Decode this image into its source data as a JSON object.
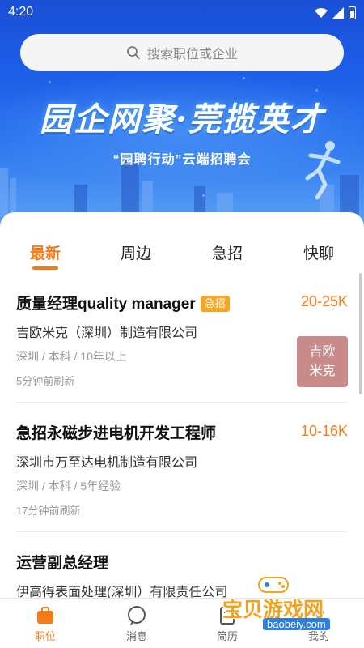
{
  "status_bar": {
    "time": "4:20"
  },
  "search": {
    "placeholder": "搜索职位或企业"
  },
  "banner": {
    "title": "园企网聚·莞揽英才",
    "subtitle": "“园聘行动”云端招聘会"
  },
  "tabs": [
    {
      "label": "最新",
      "active": true
    },
    {
      "label": "周边",
      "active": false
    },
    {
      "label": "急招",
      "active": false
    },
    {
      "label": "快聊",
      "active": false
    }
  ],
  "jobs": [
    {
      "title": "质量经理quality manager",
      "tag": "急招",
      "salary": "20-25K",
      "company": "吉欧米克（深圳）制造有限公司",
      "meta": "深圳 / 本科 / 10年以上",
      "refreshed": "5分钟前刷新",
      "logo_line1": "吉欧",
      "logo_line2": "米克"
    },
    {
      "title": "急招永磁步进电机开发工程师",
      "salary": "10-16K",
      "company": "深圳市万至达电机制造有限公司",
      "meta": "深圳 / 本科 / 5年经验",
      "refreshed": "17分钟前刷新"
    },
    {
      "title": "运营副总经理",
      "company": "伊高得表面处理(深圳）有限责任公司"
    }
  ],
  "bottom_nav": [
    {
      "label": "职位",
      "icon": "briefcase-icon",
      "active": true
    },
    {
      "label": "消息",
      "icon": "chat-bubble-icon",
      "active": false
    },
    {
      "label": "简历",
      "icon": "resume-icon",
      "active": false
    },
    {
      "label": "我的",
      "icon": "profile-icon",
      "active": false
    }
  ],
  "watermark": {
    "text": "宝贝游戏网",
    "url": "baobeiy.com"
  },
  "colors": {
    "accent": "#f07c1b",
    "banner_blue": "#1d5ee8",
    "tag_orange": "#f5a623"
  }
}
